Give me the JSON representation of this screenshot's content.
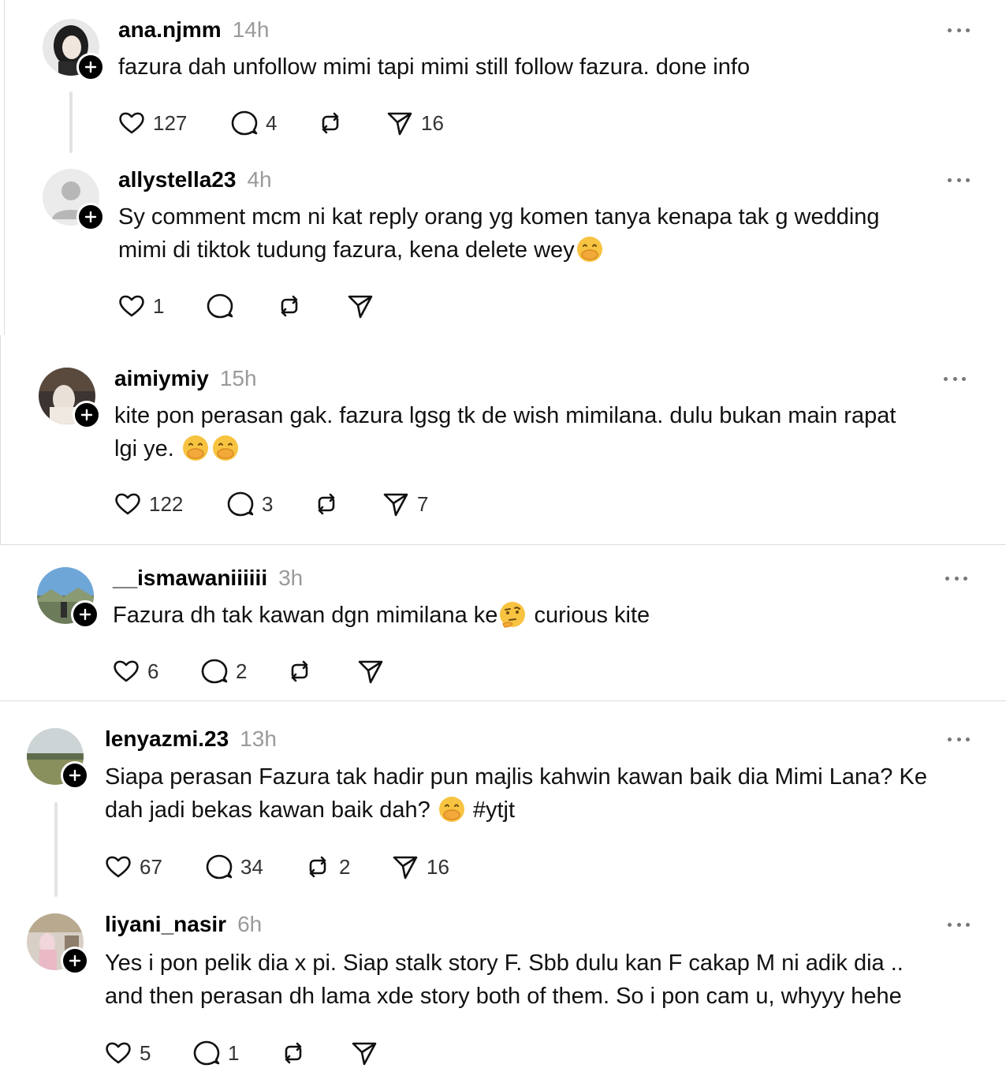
{
  "posts": [
    {
      "username": "ana.njmm",
      "time": "14h",
      "text_lines": [
        "fazura dah unfollow mimi tapi mimi still follow fazura. done info"
      ],
      "likes": "127",
      "replies": "4",
      "reposts": "",
      "shares": "16"
    },
    {
      "username": "allystella23",
      "time": "4h",
      "text_lines": [
        "Sy comment mcm ni kat reply orang yg komen tanya kenapa tak g wedding",
        "mimi di tiktok tudung fazura, kena delete wey"
      ],
      "likes": "1",
      "replies": "",
      "reposts": "",
      "shares": ""
    },
    {
      "username": "aimiymiy",
      "time": "15h",
      "text_lines": [
        "kite pon perasan gak. fazura lgsg tk de wish mimilana. dulu bukan main rapat",
        "lgi ye. "
      ],
      "likes": "122",
      "replies": "3",
      "reposts": "",
      "shares": "7"
    },
    {
      "username": "__ismawaniiiiii",
      "time": "3h",
      "text_lines": [
        "Fazura dh tak kawan dgn mimilana ke",
        " curious kite"
      ],
      "likes": "6",
      "replies": "2",
      "reposts": "",
      "shares": ""
    },
    {
      "username": "lenyazmi.23",
      "time": "13h",
      "text_lines": [
        "Siapa perasan Fazura tak hadir pun majlis kahwin kawan baik dia Mimi Lana? Ke",
        "dah jadi bekas kawan baik dah? ",
        " #ytjt"
      ],
      "likes": "67",
      "replies": "34",
      "reposts": "2",
      "shares": "16"
    },
    {
      "username": "liyani_nasir",
      "time": "6h",
      "text_lines": [
        "Yes i pon pelik dia x pi. Siap stalk story F. Sbb dulu kan F cakap M ni adik dia ..",
        "and then perasan dh lama xde story both of them. So i pon cam u, whyyy hehe"
      ],
      "likes": "5",
      "replies": "1",
      "reposts": "",
      "shares": ""
    }
  ],
  "icons": {
    "like": "heart-icon",
    "reply": "comment-icon",
    "repost": "repost-icon",
    "share": "send-icon",
    "more": "more-icon",
    "follow": "plus-icon",
    "emoji_shush": "hand-over-mouth-emoji",
    "emoji_think": "thinking-face-emoji"
  },
  "colors": {
    "muted": "#9a9a9a",
    "text": "#111111",
    "badge": "#000000"
  }
}
